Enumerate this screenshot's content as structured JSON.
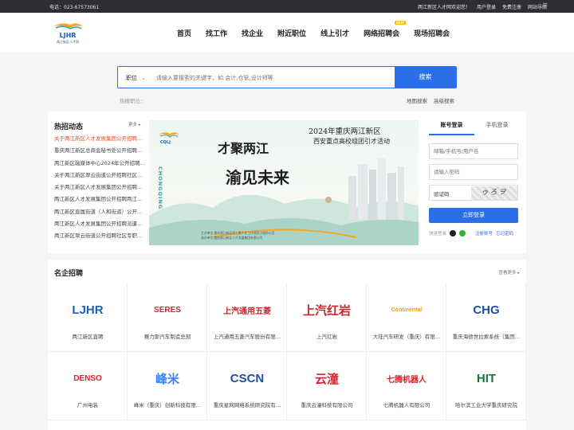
{
  "topbar": {
    "phone": "电话：023-67573061",
    "welcome": "两江新区人才网欢迎您！",
    "login": "用户登录",
    "register": "免费注册",
    "sitemap": "网站导航"
  },
  "header": {
    "logo_text": "LJHR",
    "logo_sub": "两江新区人才网",
    "nav": [
      "首页",
      "找工作",
      "找企业",
      "附近职位",
      "线上引才",
      "网络招聘会",
      "现场招聘会"
    ],
    "nav_badge": "NEW"
  },
  "search": {
    "category": "职位",
    "placeholder": "请输入要搜索的关键字，如 会计,仓管,设计师等",
    "button": "搜索",
    "hot_label": "热搜职位：",
    "map_search": "地图搜索",
    "advanced_search": "高级搜索"
  },
  "news": {
    "title": "热招动态",
    "more": "更多",
    "items": [
      "关于两江新区人才发展集团公开招聘…",
      "重庆两江新区总商会秘书处公开招聘…",
      "两江新区融媒体中心2024年公开招聘…",
      "关于两江新区翠云街道公开招聘社区…",
      "关于两江新区人才发展集团公开招聘…",
      "两江新区人才发展集团公开招聘两江…",
      "两江新区直属街道（人和街道）公开…",
      "两江新区人才发展集团公开招聘派遣…",
      "两江新区翠云街道公开招聘社区专职…"
    ]
  },
  "banner": {
    "title": "2024年重庆两江新区",
    "subtitle": "西安重点高校组团引才活动",
    "slogan_1": "才聚两江",
    "slogan_2": "渝见未来",
    "city": "CHONGQING",
    "logo": "CQLJ",
    "organizer_1": "主办单位:重庆两江新区党工委人才工作领导小组办公室",
    "organizer_2": "承办单位:重庆两江新区人才发展集团有限公司"
  },
  "login": {
    "tab_account": "账号登录",
    "tab_phone": "手机登录",
    "username_placeholder": "邮箱/手机号/用户名",
    "password_placeholder": "请输入密码",
    "captcha_label": "验证码",
    "captcha_text": "ゥろヲ",
    "submit": "立即登录",
    "quick_label": "快速登录",
    "register": "注册账号",
    "forgot": "忘记密码"
  },
  "companies": {
    "title": "名企招聘",
    "more": "查看更多",
    "items": [
      {
        "name": "两江新区直聘",
        "logo": "LJHR",
        "color": "#1d5fb7"
      },
      {
        "name": "赛力斯汽车制造总部",
        "logo": "SERES",
        "color": "#c8272d"
      },
      {
        "name": "上汽通用五菱汽车股份有限…",
        "logo": "上汽通用五菱",
        "color": "#c8272d"
      },
      {
        "name": "上汽红岩",
        "logo": "上汽红岩",
        "color": "#c8272d"
      },
      {
        "name": "大陆汽车研发（重庆）有限…",
        "logo": "Continental",
        "color": "#f39c12"
      },
      {
        "name": "重庆海德世拉索系统（集团…",
        "logo": "CHG",
        "color": "#1d4fa0"
      },
      {
        "name": "广州电装",
        "logo": "DENSO",
        "color": "#d9222a"
      },
      {
        "name": "峰米（重庆）创新科技有限…",
        "logo": "峰米",
        "color": "#3b82f6"
      },
      {
        "name": "重庆星网网络系统研究院有…",
        "logo": "CSCN",
        "color": "#1d4fa0"
      },
      {
        "name": "重庆云潼科技有限公司",
        "logo": "云潼",
        "color": "#d9222a"
      },
      {
        "name": "七腾机器人有限公司",
        "logo": "七腾机器人",
        "color": "#d9222a"
      },
      {
        "name": "哈尔滨工业大学重庆研究院",
        "logo": "HIT",
        "color": "#0f7a3e"
      }
    ]
  }
}
